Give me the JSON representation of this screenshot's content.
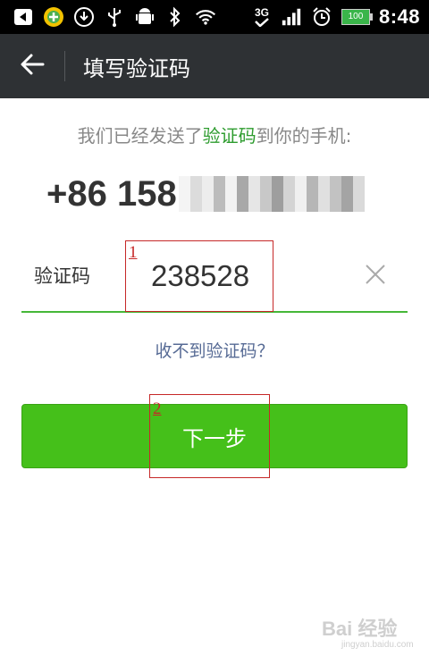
{
  "status_bar": {
    "time": "8:48",
    "battery_level": "100",
    "network_label": "3G",
    "icons": [
      "back-notification-icon",
      "360-shield-icon",
      "download-icon",
      "usb-icon",
      "android-debug-icon",
      "bluetooth-icon",
      "wifi-icon",
      "3g-signal-icon",
      "cell-signal-icon",
      "alarm-icon",
      "battery-icon"
    ]
  },
  "header": {
    "title": "填写验证码",
    "back_icon": "arrow-left-icon"
  },
  "main": {
    "hint_prefix": "我们已经发送了",
    "hint_highlight": "验证码",
    "hint_suffix": "到你的手机:",
    "phone_prefix": "+86 158",
    "code_label": "验证码",
    "code_value": "238528",
    "clear_icon": "close-icon",
    "no_code_link": "收不到验证码？",
    "next_button": "下一步"
  },
  "annotations": {
    "box1_number": "1",
    "box2_number": "2"
  },
  "watermark": {
    "logo": "Bai 经验",
    "url": "jingyan.baidu.com"
  },
  "colors": {
    "accent_green": "#45c01a",
    "highlight_green": "#2e9c2f",
    "link_blue": "#576b95",
    "header_bg": "#2e3134",
    "annotation_red": "#c62828"
  }
}
